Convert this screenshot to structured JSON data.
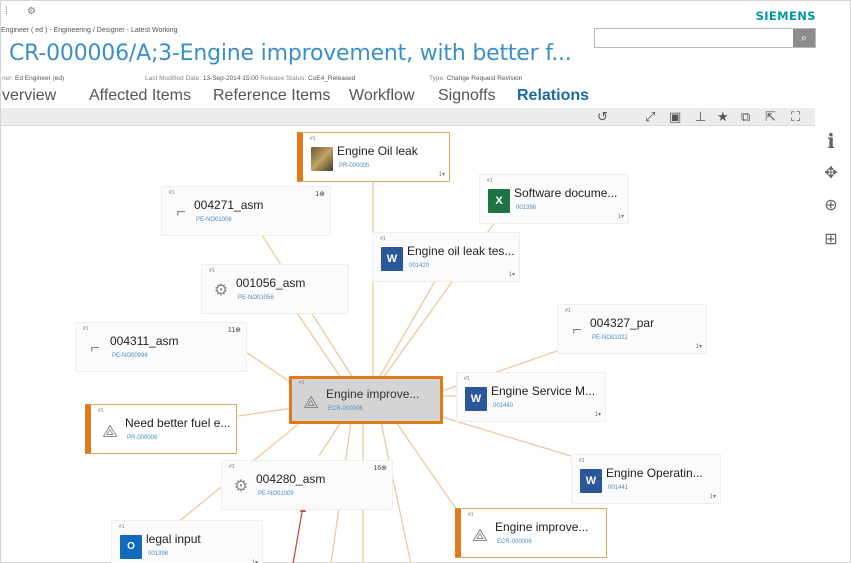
{
  "brand": "SIEMENS",
  "header": {
    "breadcrumb": "Engineer ( ed ) - Engineering / Designer - Latest Working",
    "title": "CR-000006/A;3-Engine improvement, with better f...",
    "owner_label": "ner:",
    "owner_value": "Ed Engineer (ed)",
    "modified_label": "Last Modified Date:",
    "modified_value": "13-Sep-2014 15:00",
    "status_label": "Release Status:",
    "status_value": "CoE4_Released",
    "type_label": "Type:",
    "type_value": "Change Request Revision"
  },
  "search": {
    "placeholder": ""
  },
  "tabs": [
    {
      "label": "verview"
    },
    {
      "label": "Affected Items"
    },
    {
      "label": "Reference Items"
    },
    {
      "label": "Workflow"
    },
    {
      "label": "Signoffs"
    },
    {
      "label": "Relations",
      "active": true
    }
  ],
  "toolbar_icons": [
    "undo-icon",
    "expand-icon",
    "layout-icon",
    "pin-icon",
    "star-icon",
    "copy-icon",
    "share-icon",
    "fullscreen-icon"
  ],
  "rail_icons": [
    "info-icon",
    "move-icon",
    "add-icon",
    "tree-icon"
  ],
  "colors": {
    "accent": "#3a8fc9",
    "tab_active": "#1a6aa6",
    "edge": "#f2c89a",
    "highlight": "#e07b1a",
    "red_edge": "#d04a4a"
  },
  "nodes": [
    {
      "id": "oil_leak",
      "title": "Engine Oil leak",
      "sub": "PR-000005",
      "icon": "photo-icon",
      "style": "orange",
      "count": "1▾"
    },
    {
      "id": "software_doc",
      "title": "Software docume...",
      "sub": "001396",
      "icon": "excel-icon",
      "style": "plain",
      "count": "1▾"
    },
    {
      "id": "asm_004271",
      "title": "004271_asm",
      "sub": "PE-NO01006",
      "icon": "part-icon",
      "style": "plain",
      "corner": "1⊕"
    },
    {
      "id": "oil_leak_test",
      "title": "Engine oil leak tes...",
      "sub": "001420",
      "icon": "word-icon",
      "style": "plain",
      "count": "1▾"
    },
    {
      "id": "asm_001056",
      "title": "001056_asm",
      "sub": "PE-NO01056",
      "icon": "part-icon",
      "style": "plain"
    },
    {
      "id": "par_004327",
      "title": "004327_par",
      "sub": "PE-NO01022",
      "icon": "part-icon",
      "style": "plain",
      "count": "1▾"
    },
    {
      "id": "asm_004311",
      "title": "004311_asm",
      "sub": "PE-NO00996",
      "icon": "part-icon",
      "style": "plain",
      "corner": "11⊕"
    },
    {
      "id": "center",
      "title": "Engine improve...",
      "sub": "ECR-000006",
      "icon": "cr-icon",
      "style": "center"
    },
    {
      "id": "service_manual",
      "title": "Engine Service M...",
      "sub": "001440",
      "icon": "word-icon",
      "style": "plain",
      "count": "1▾"
    },
    {
      "id": "fuel",
      "title": "Need better fuel e...",
      "sub": "PR-000006",
      "icon": "cr-icon",
      "style": "orange"
    },
    {
      "id": "asm_004280",
      "title": "004280_asm",
      "sub": "PE-NO01009",
      "icon": "part-icon",
      "style": "plain",
      "corner": "16⊕"
    },
    {
      "id": "operating",
      "title": "Engine Operatin...",
      "sub": "001441",
      "icon": "word-icon",
      "style": "plain",
      "count": "1▾"
    },
    {
      "id": "legal",
      "title": "legal input",
      "sub": "001398",
      "icon": "outlook-icon",
      "style": "plain",
      "count": "1▾"
    },
    {
      "id": "improve2",
      "title": "Engine improve...",
      "sub": "ECR-000006",
      "icon": "cr-icon",
      "style": "orange"
    }
  ]
}
